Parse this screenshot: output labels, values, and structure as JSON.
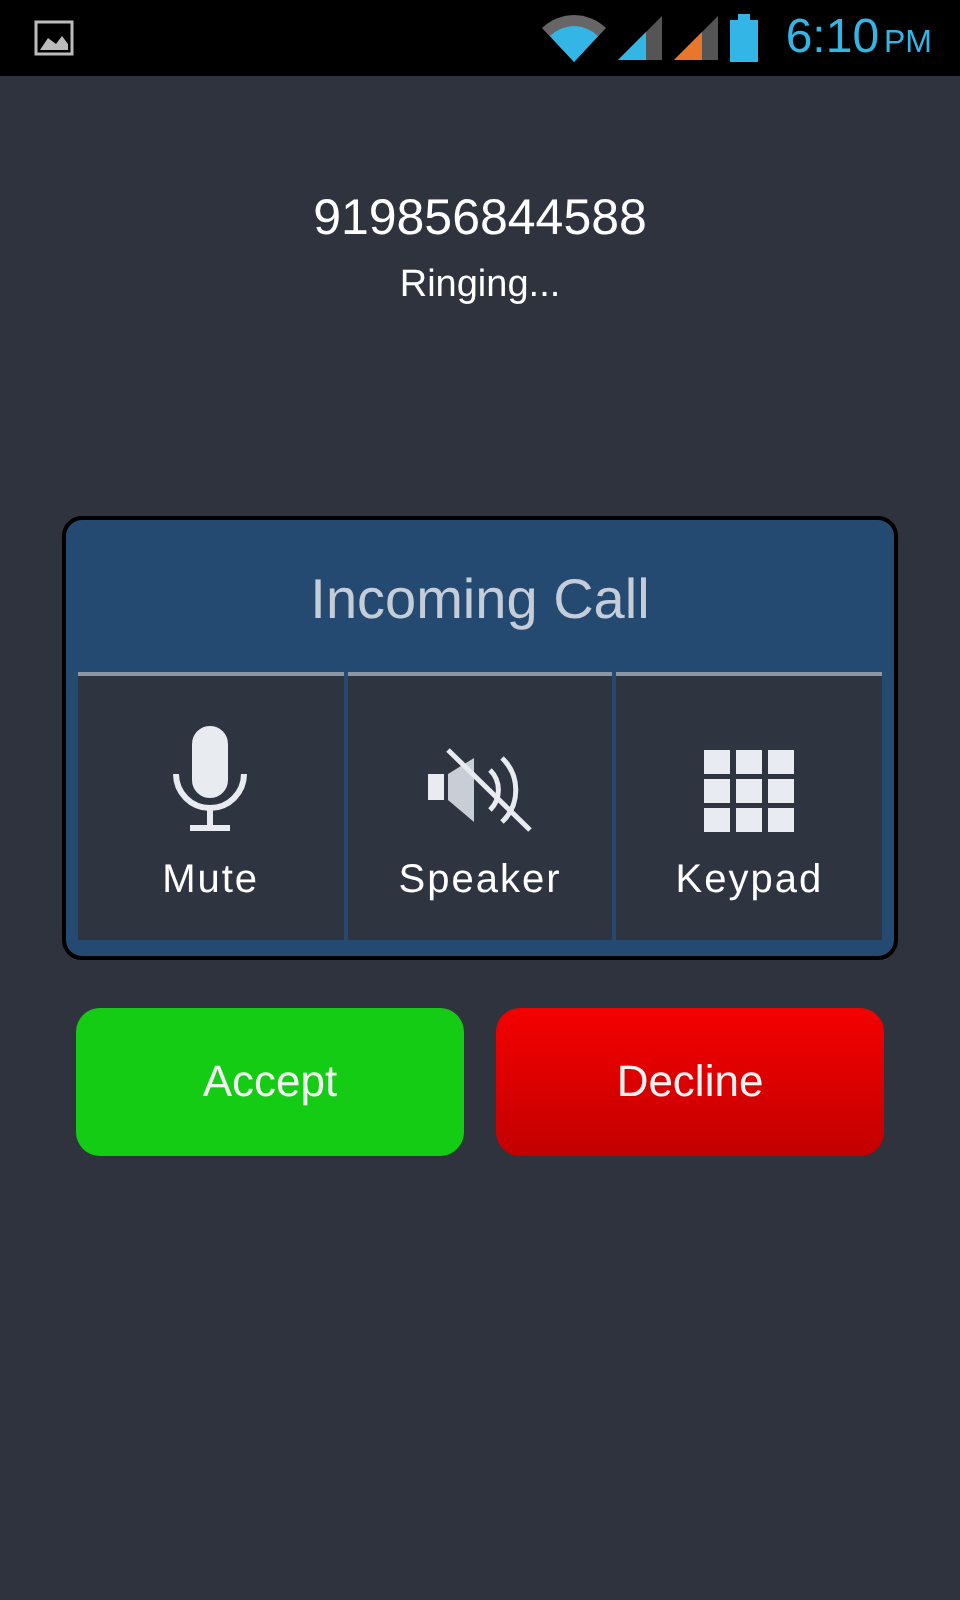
{
  "status_bar": {
    "time": "6:10",
    "period": "PM"
  },
  "caller": {
    "number": "919856844588",
    "status": "Ringing..."
  },
  "panel": {
    "title": "Incoming Call",
    "options": [
      {
        "kind": "mic",
        "label": "Mute"
      },
      {
        "kind": "speaker",
        "label": "Speaker"
      },
      {
        "kind": "keypad",
        "label": "Keypad"
      }
    ]
  },
  "buttons": [
    {
      "kind": "accept",
      "label": "Accept"
    },
    {
      "kind": "decline",
      "label": "Decline"
    }
  ]
}
